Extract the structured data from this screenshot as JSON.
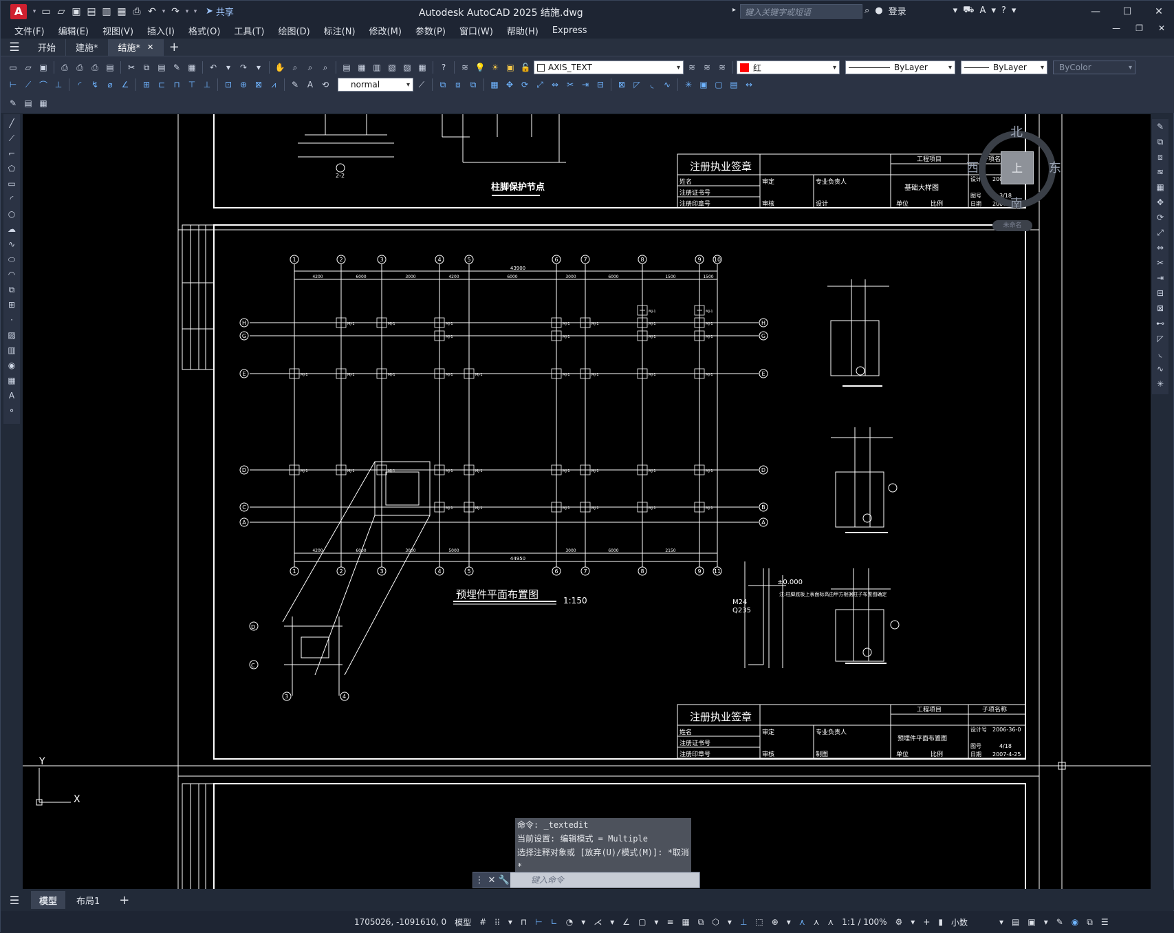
{
  "app": {
    "logo": "A",
    "title": "Autodesk AutoCAD 2025    结施.dwg",
    "share": "共享",
    "search_placeholder": "键入关键字或短语",
    "signin": "登录"
  },
  "menus": [
    "文件(F)",
    "编辑(E)",
    "视图(V)",
    "插入(I)",
    "格式(O)",
    "工具(T)",
    "绘图(D)",
    "标注(N)",
    "修改(M)",
    "参数(P)",
    "窗口(W)",
    "帮助(H)",
    "Express"
  ],
  "file_tabs": [
    {
      "label": "开始",
      "active": false
    },
    {
      "label": "建施*",
      "active": false
    },
    {
      "label": "结施*",
      "active": true
    }
  ],
  "toolbar": {
    "layer": "AXIS_TEXT",
    "color": "红",
    "linetype": "ByLayer",
    "lineweight": "ByLayer",
    "plotstyle": "ByColor",
    "text_style": "normal"
  },
  "viewcube": {
    "north": "北",
    "south": "南",
    "east": "东",
    "west": "西",
    "top": "上",
    "wcs": "未命名"
  },
  "drawing": {
    "sheet1_detail_title": "柱脚保护节点",
    "detail_2_2": "2-2",
    "stamp_title": "注册执业签章",
    "tb_project": "工程项目",
    "tb_sub": "子项名称",
    "tb_name": "姓名",
    "tb_cert": "注册证书号",
    "tb_seal": "注册印章号",
    "tb_specialty": "专业负责人",
    "tb_check": "审核",
    "tb_approve": "审定",
    "tb_design": "设计",
    "tb_draw": "制图",
    "tb_unit": "单位",
    "tb_scale": "比例",
    "tb_date": "日期",
    "tb_dwg_no": "图号",
    "tb_design_no": "设计号",
    "sheet1_name": "基础大样图",
    "sheet1_no": "3/18",
    "sheet2_name": "预埋件平面布置图",
    "sheet2_no": "4/18",
    "design_no": "2006-36-0",
    "date": "2007-4-25",
    "plan_title": "预埋件平面布置图",
    "plan_scale": "1:150",
    "axes_top": [
      "1",
      "2",
      "3",
      "4",
      "5",
      "6",
      "7",
      "8",
      "9",
      "10"
    ],
    "axes_bottom": [
      "1",
      "2",
      "3",
      "4",
      "5",
      "6",
      "7",
      "8",
      "9",
      "11"
    ],
    "axes_left": [
      "H",
      "G",
      "E",
      "D",
      "C",
      "A"
    ],
    "axes_right": [
      "H",
      "G",
      "E",
      "D",
      "B",
      "A"
    ],
    "dims_top": [
      "4200",
      "6000",
      "3000",
      "4200",
      "6000",
      "3000",
      "6000",
      "1500",
      "1500"
    ],
    "dims_bottom": [
      "4200",
      "6000",
      "3000",
      "5000",
      "3000",
      "6000",
      "2150"
    ],
    "total_top": "43900",
    "total_bottom": "44950",
    "embed_label": "MJ-1",
    "level": "±0.000",
    "bolt": "M24",
    "steel": "Q235",
    "anchor_note": "注:柱脚底板上表面标高由甲方根据柱子布置图确定"
  },
  "command": {
    "history": [
      "命令: _textedit",
      "当前设置: 编辑模式 = Multiple",
      "选择注释对象或 [放弃(U)/模式(M)]: *取消*"
    ],
    "placeholder": "键入命令"
  },
  "layout_tabs": [
    {
      "label": "模型",
      "active": true
    },
    {
      "label": "布局1",
      "active": false
    }
  ],
  "status": {
    "coords": "1705026, -1091610, 0",
    "mode": "模型",
    "scale": "1:1 / 100%",
    "units": "小数"
  }
}
